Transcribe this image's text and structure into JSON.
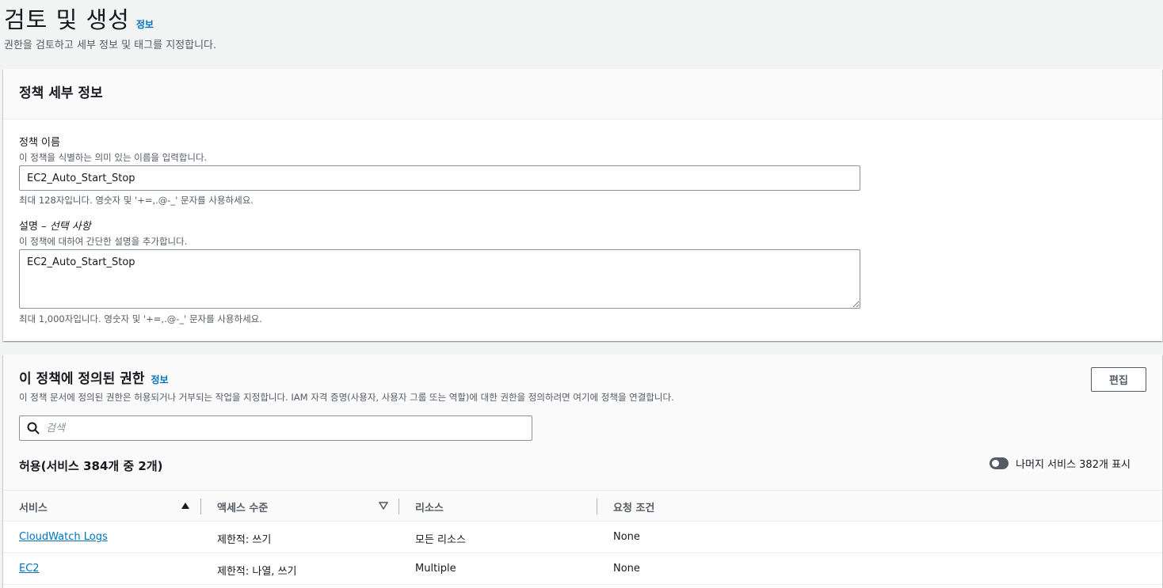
{
  "page": {
    "title": "검토 및 생성",
    "info": "정보",
    "description": "권한을 검토하고 세부 정보 및 태그를 지정합니다."
  },
  "policy_details": {
    "heading": "정책 세부 정보",
    "name": {
      "label": "정책 이름",
      "description": "이 정책을 식별하는 의미 있는 이름을 입력합니다.",
      "value": "EC2_Auto_Start_Stop",
      "hint": "최대 128자입니다. 영숫자 및 '+=,.@-_' 문자를 사용하세요."
    },
    "desc": {
      "label": "설명 – ",
      "label_optional": "선택 사항",
      "description": "이 정책에 대하여 간단한 설명을 추가합니다.",
      "value": "EC2_Auto_Start_Stop",
      "hint": "최대 1,000자입니다. 영숫자 및 '+=,.@-_' 문자를 사용하세요."
    }
  },
  "permissions": {
    "heading": "이 정책에 정의된 권한",
    "info": "정보",
    "description": "이 정책 문서에 정의된 권한은 허용되거나 거부되는 작업을 지정합니다. IAM 자격 증명(사용자, 사용자 그룹 또는 역할)에 대한 권한을 정의하려면 여기에 정책을 연결합니다.",
    "edit_label": "편집",
    "search_placeholder": "검색",
    "count_title": "허용(서비스 384개 중 2개)",
    "toggle_label": "나머지 서비스 382개 표시",
    "toggle_on": false,
    "columns": [
      "서비스",
      "액세스 수준",
      "리소스",
      "요청 조건"
    ],
    "rows": [
      {
        "service": "CloudWatch Logs",
        "access": "제한적: 쓰기",
        "resource": "모든 리소스",
        "condition": "None"
      },
      {
        "service": "EC2",
        "access": "제한적: 나열, 쓰기",
        "resource": "Multiple",
        "condition": "None"
      }
    ]
  }
}
